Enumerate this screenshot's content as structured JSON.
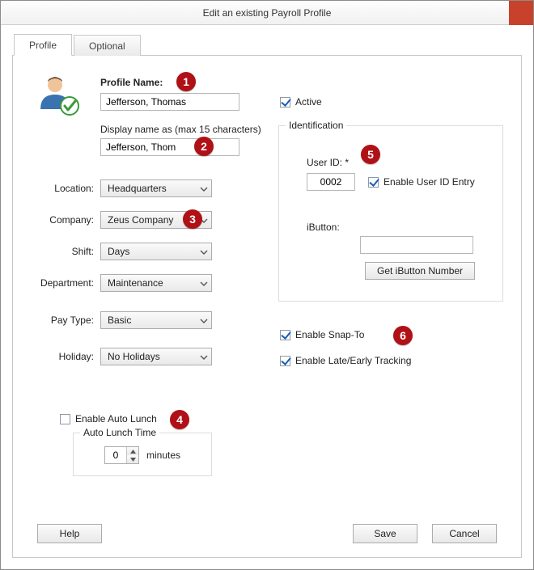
{
  "title": "Edit an existing Payroll Profile",
  "tabs": {
    "profile": "Profile",
    "optional": "Optional"
  },
  "labels": {
    "profile_name": "Profile Name:",
    "display_name": "Display name as (max 15 characters)",
    "location": "Location:",
    "company": "Company:",
    "shift": "Shift:",
    "department": "Department:",
    "pay_type": "Pay Type:",
    "holiday": "Holiday:",
    "active": "Active",
    "identification": "Identification",
    "user_id": "User ID: *",
    "enable_user_id_entry": "Enable User ID Entry",
    "ibutton": "iButton:",
    "get_ibutton": "Get iButton Number",
    "enable_snapto": "Enable Snap-To",
    "enable_late_early": "Enable Late/Early Tracking",
    "enable_auto_lunch": "Enable Auto Lunch",
    "auto_lunch_time": "Auto Lunch Time",
    "minutes": "minutes"
  },
  "values": {
    "profile_name": "Jefferson, Thomas",
    "display_name": "Jefferson, Thom",
    "location": "Headquarters",
    "company": "Zeus Company",
    "shift": "Days",
    "department": "Maintenance",
    "pay_type": "Basic",
    "holiday": "No Holidays",
    "active": true,
    "user_id": "0002",
    "enable_user_id_entry": true,
    "ibutton": "",
    "enable_snapto": true,
    "enable_late_early": true,
    "enable_auto_lunch": false,
    "auto_lunch_minutes": "0"
  },
  "buttons": {
    "help": "Help",
    "save": "Save",
    "cancel": "Cancel"
  },
  "markers": {
    "m1": "1",
    "m2": "2",
    "m3": "3",
    "m4": "4",
    "m5": "5",
    "m6": "6"
  }
}
